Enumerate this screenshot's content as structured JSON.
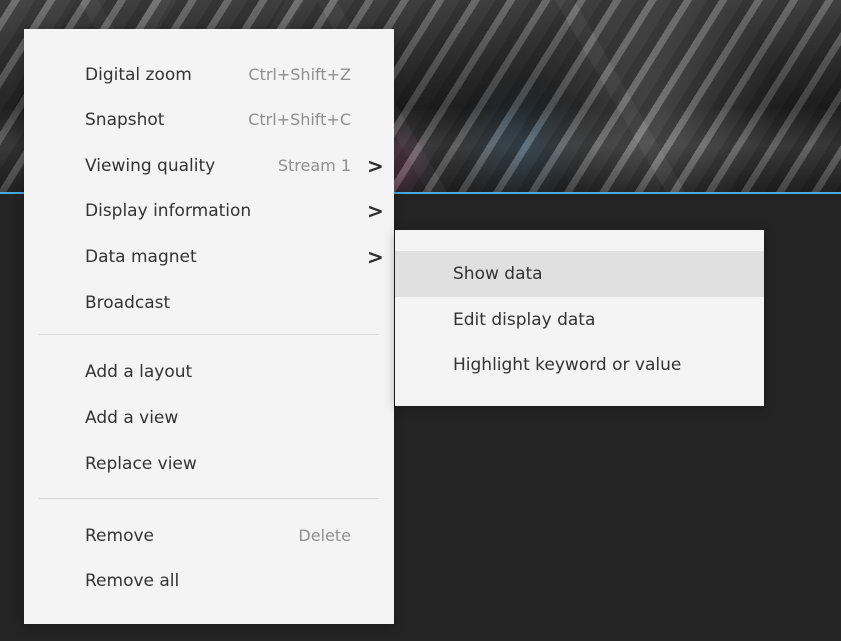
{
  "context_menu": {
    "items": [
      {
        "label": "Digital zoom",
        "shortcut": "Ctrl+Shift+Z"
      },
      {
        "label": "Snapshot",
        "shortcut": "Ctrl+Shift+C"
      },
      {
        "label": "Viewing quality",
        "value": "Stream 1",
        "arrow": ">"
      },
      {
        "label": "Display information",
        "arrow": ">"
      },
      {
        "label": "Data magnet",
        "arrow": ">"
      },
      {
        "label": "Broadcast"
      },
      {
        "label": "Add a layout"
      },
      {
        "label": "Add a view"
      },
      {
        "label": "Replace view"
      },
      {
        "label": "Remove",
        "shortcut": "Delete"
      },
      {
        "label": "Remove all"
      }
    ]
  },
  "submenu": {
    "items": [
      {
        "label": "Show data"
      },
      {
        "label": "Edit display data"
      },
      {
        "label": "Highlight keyword or value"
      }
    ]
  }
}
